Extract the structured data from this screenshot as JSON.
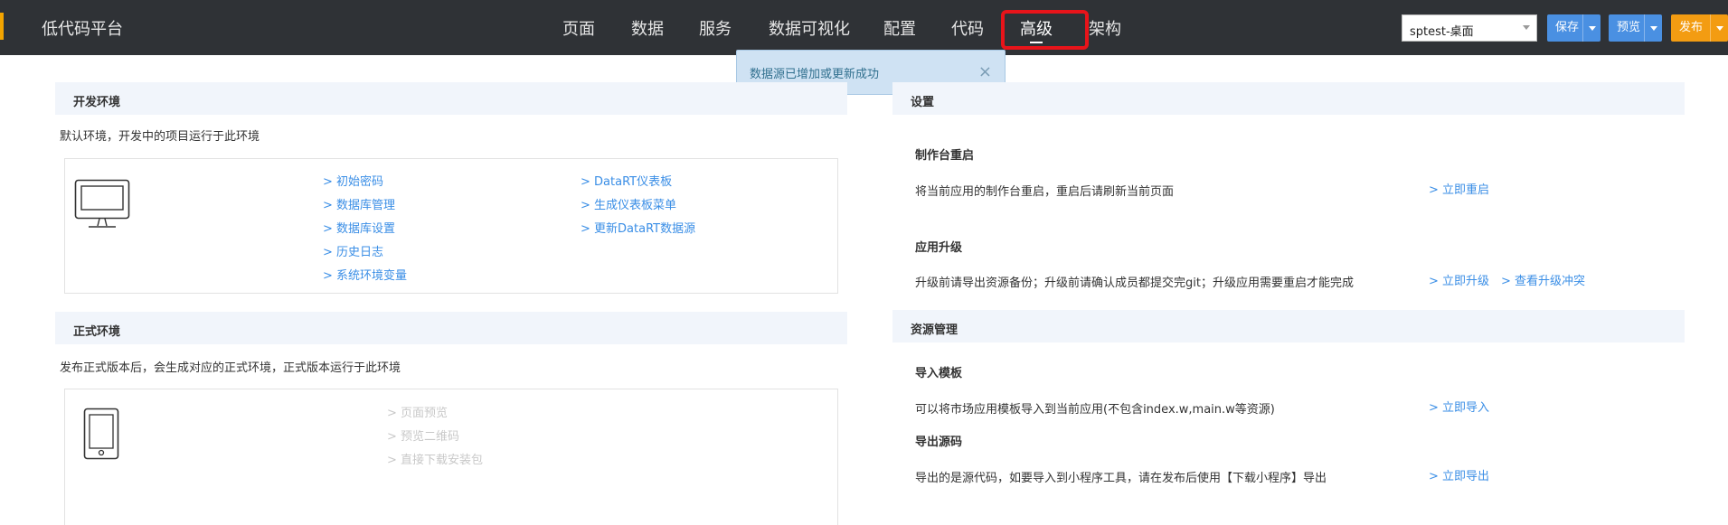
{
  "app": {
    "brand": "低代码平台"
  },
  "nav": {
    "items": [
      {
        "label": "页面"
      },
      {
        "label": "数据"
      },
      {
        "label": "服务"
      },
      {
        "label": "数据可视化"
      },
      {
        "label": "配置"
      },
      {
        "label": "代码"
      },
      {
        "label": "高级",
        "active": true
      },
      {
        "label": "架构"
      }
    ]
  },
  "toolbar": {
    "env_select_value": "sptest-桌面",
    "save_label": "保存",
    "preview_label": "预览",
    "publish_label": "发布"
  },
  "toast": {
    "message": "数据源已增加或更新成功",
    "close": "×"
  },
  "dev_env": {
    "title": "开发环境",
    "desc": "默认环境，开发中的项目运行于此环境",
    "links_col1": [
      "> 初始密码",
      "> 数据库管理",
      "> 数据库设置",
      "> 历史日志",
      "> 系统环境变量"
    ],
    "links_col2": [
      "> DataRT仪表板",
      "> 生成仪表板菜单",
      "> 更新DataRT数据源"
    ]
  },
  "prod_env": {
    "title": "正式环境",
    "desc": "发布正式版本后，会生成对应的正式环境，正式版本运行于此环境",
    "links": [
      "> 页面预览",
      "> 预览二维码",
      "> 直接下载安装包"
    ]
  },
  "settings": {
    "title": "设置",
    "restart_title": "制作台重启",
    "restart_desc": "将当前应用的制作台重启，重启后请刷新当前页面",
    "restart_link": "> 立即重启",
    "upgrade_title": "应用升级",
    "upgrade_desc": "升级前请导出资源备份；升级前请确认成员都提交完git；升级应用需要重启才能完成",
    "upgrade_link": "> 立即升级",
    "conflict_link": "> 查看升级冲突"
  },
  "resources": {
    "title": "资源管理",
    "import_title": "导入模板",
    "import_desc": "可以将市场应用模板导入到当前应用(不包含index.w,main.w等资源)",
    "import_link": "> 立即导入",
    "export_title": "导出源码",
    "export_desc": "导出的是源代码，如要导入到小程序工具，请在发布后使用【下载小程序】导出",
    "export_link": "> 立即导出"
  },
  "colors": {
    "topbar": "#2f3236",
    "accent": "#f2a400",
    "link": "#3a8ee6",
    "highlight": "#e8141a",
    "section_bg": "#f1f5fb"
  }
}
